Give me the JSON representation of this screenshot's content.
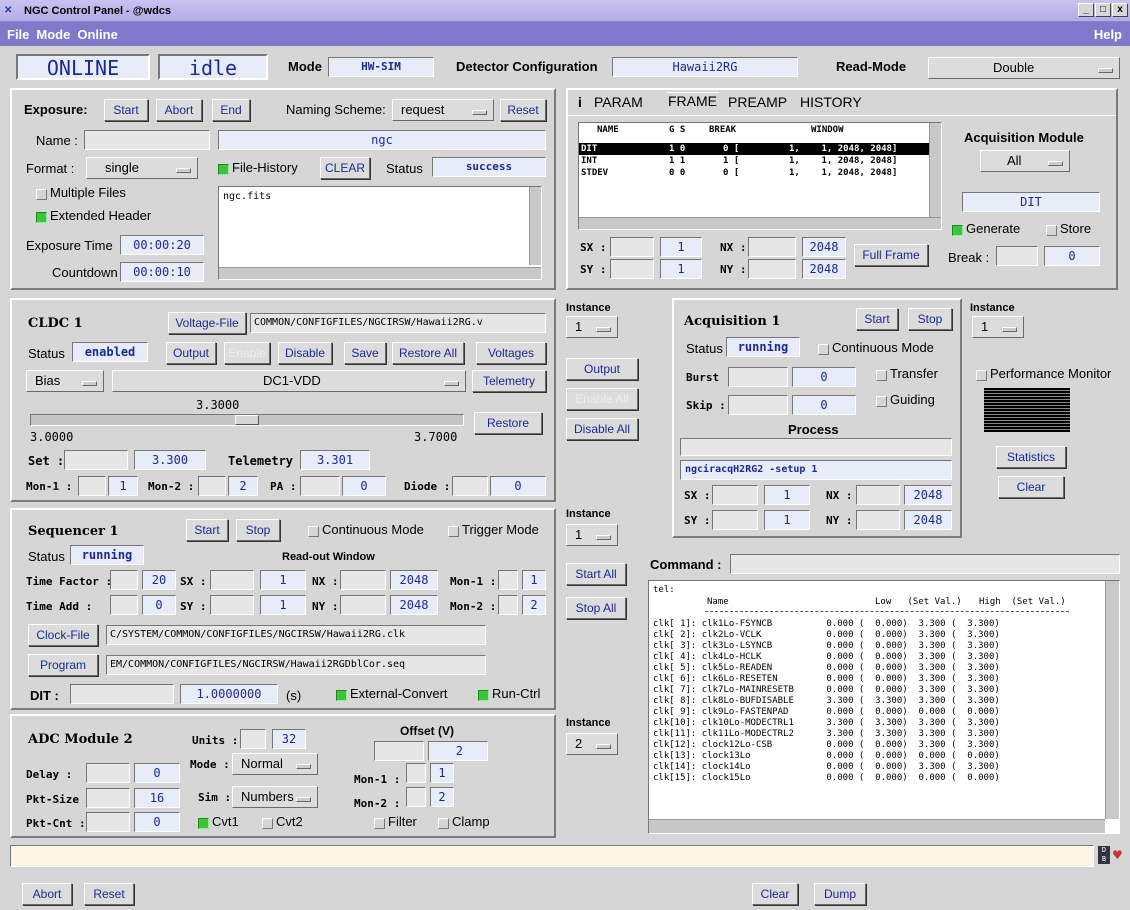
{
  "window": {
    "title": "NGC Control Panel - @wdcs",
    "logo": "NGC",
    "min": "_",
    "max": "□",
    "close": "x"
  },
  "menu": {
    "file": "File",
    "mode": "Mode",
    "online": "Online",
    "help": "Help"
  },
  "topbar": {
    "online": "ONLINE",
    "state": "idle",
    "mode_label": "Mode",
    "mode_value": "HW-SIM",
    "det_label": "Detector Configuration",
    "det_value": "Hawaii2RG",
    "read_label": "Read-Mode",
    "read_value": "Double"
  },
  "exposure": {
    "title": "Exposure:",
    "start": "Start",
    "abort": "Abort",
    "end": "End",
    "naming_label": "Naming Scheme:",
    "naming_value": "request",
    "reset": "Reset",
    "name_label": "Name :",
    "name_value": "",
    "name_display": "ngc",
    "format_label": "Format :",
    "format_value": "single",
    "file_history": "File-History",
    "clear": "CLEAR",
    "status_label": "Status",
    "status_value": "success",
    "multiple_files": "Multiple Files",
    "extended_header": "Extended Header",
    "file_list": "ngc.fits",
    "exptime_label": "Exposure Time",
    "exptime_value": "00:00:20",
    "countdown_label": "Countdown",
    "countdown_value": "00:00:10"
  },
  "frame": {
    "tabs": [
      "i",
      "PARAM",
      "FRAME",
      "PREAMP",
      "HISTORY"
    ],
    "headers": {
      "name": "NAME",
      "gs": "G S",
      "brk": "BREAK",
      "win": "WINDOW"
    },
    "rows": [
      {
        "name": "DIT",
        "gs": "1 0",
        "brk": "0 [",
        "win": "1,    1, 2048, 2048]"
      },
      {
        "name": "INT",
        "gs": "1 1",
        "brk": "1 [",
        "win": "1,    1, 2048, 2048]"
      },
      {
        "name": "STDEV",
        "gs": "0 0",
        "brk": "0 [",
        "win": "1,    1, 2048, 2048]"
      }
    ],
    "sx_label": "SX :",
    "sx": "1",
    "nx_label": "NX :",
    "nx": "2048",
    "sy_label": "SY :",
    "sy": "1",
    "ny_label": "NY :",
    "ny": "2048",
    "full_frame": "Full Frame",
    "acq_mod_label": "Acquisition Module",
    "acq_mod_value": "All",
    "dit": "DIT",
    "generate": "Generate",
    "store": "Store",
    "break_label": "Break :",
    "break_value": "0"
  },
  "cldc": {
    "title": "CLDC 1",
    "voltage_file": "Voltage-File",
    "voltage_path": "COMMON/CONFIGFILES/NGCIRSW/Hawaii2RG.v",
    "status_label": "Status",
    "status_value": "enabled",
    "output": "Output",
    "enable": "Enable",
    "disable": "Disable",
    "save": "Save",
    "restore_all": "Restore All",
    "voltages": "Voltages",
    "bias": "Bias",
    "dc": "DC1-VDD",
    "telemetry": "Telemetry",
    "slider_value": "3.3000",
    "slider_level": 0.5,
    "min": "3.0000",
    "max": "3.7000",
    "restore": "Restore",
    "set_label": "Set :",
    "set_value": "3.300",
    "tel_label": "Telemetry :",
    "tel_value": "3.301",
    "mon1_label": "Mon-1 :",
    "mon1": "1",
    "mon2_label": "Mon-2 :",
    "mon2": "2",
    "pa_label": "PA :",
    "pa": "0",
    "diode_label": "Diode :",
    "diode": "0"
  },
  "instances": {
    "label": "Instance",
    "i1": "1",
    "i2": "1",
    "i3": "1",
    "i4": "2",
    "output": "Output",
    "enable_all": "Enable All",
    "disable_all": "Disable All",
    "start_all": "Start All",
    "stop_all": "Stop All"
  },
  "acq": {
    "title": "Acquisition 1",
    "start": "Start",
    "stop": "Stop",
    "status_label": "Status",
    "status_value": "running",
    "continuous": "Continuous Mode",
    "burst_label": "Burst :",
    "burst": "0",
    "transfer": "Transfer",
    "skip_label": "Skip :",
    "skip": "0",
    "guiding": "Guiding",
    "process_label": "Process",
    "process_value": "ngciracqH2RG2 -setup 1",
    "sx_label": "SX :",
    "sx": "1",
    "nx_label": "NX :",
    "nx": "2048",
    "sy_label": "SY :",
    "sy": "1",
    "ny_label": "NY :",
    "ny": "2048"
  },
  "perf": {
    "performance": "Performance Monitor",
    "statistics": "Statistics",
    "clear": "Clear"
  },
  "seq": {
    "title": "Sequencer 1",
    "start": "Start",
    "stop": "Stop",
    "continuous": "Continuous Mode",
    "trigger": "Trigger Mode",
    "status_label": "Status",
    "status_value": "running",
    "readout": "Read-out Window",
    "tf_label": "Time Factor :",
    "tf": "20",
    "sx_label": "SX :",
    "sx": "1",
    "nx_label": "NX :",
    "nx": "2048",
    "mon1_label": "Mon-1 :",
    "mon1": "1",
    "ta_label": "Time Add :",
    "ta": "0",
    "sy_label": "SY :",
    "sy": "1",
    "ny_label": "NY :",
    "ny": "2048",
    "mon2_label": "Mon-2 :",
    "mon2": "2",
    "clock_file": "Clock-File",
    "clock_path": "C/SYSTEM/COMMON/CONFIGFILES/NGCIRSW/Hawaii2RG.clk",
    "program": "Program",
    "program_path": "EM/COMMON/CONFIGFILES/NGCIRSW/Hawaii2RGDblCor.seq",
    "dit_label": "DIT :",
    "dit": "1.0000000",
    "dit_unit": "(s)",
    "ext_convert": "External-Convert",
    "run_ctrl": "Run-Ctrl"
  },
  "adc": {
    "title": "ADC Module 2",
    "units_label": "Units :",
    "units": "32",
    "offset_label": "Offset (V)",
    "offset": "2",
    "delay_label": "Delay :",
    "delay": "0",
    "mode_label": "Mode :",
    "mode": "Normal",
    "mon1_label": "Mon-1 :",
    "mon1": "1",
    "pkt_size_label": "Pkt-Size :",
    "pkt_size": "16",
    "sim_label": "Sim :",
    "sim": "Numbers",
    "mon2_label": "Mon-2 :",
    "mon2": "2",
    "pkt_cnt_label": "Pkt-Cnt :",
    "pkt_cnt": "0",
    "cvt1": "Cvt1",
    "cvt2": "Cvt2",
    "filter": "Filter",
    "clamp": "Clamp"
  },
  "command": {
    "label": "Command :",
    "value": "",
    "tel": "tel:",
    "col_name": "Name",
    "col_low": "Low   (Set Val.)",
    "col_high": "High  (Set Val.)",
    "rows": [
      "clk[ 1]: clk1Lo-FSYNCB          0.000 (  0.000)  3.300 (  3.300)",
      "clk[ 2]: clk2Lo-VCLK            0.000 (  0.000)  3.300 (  3.300)",
      "clk[ 3]: clk3Lo-LSYNCB          0.000 (  0.000)  3.300 (  3.300)",
      "clk[ 4]: clk4Lo-HCLK            0.000 (  0.000)  3.300 (  3.300)",
      "clk[ 5]: clk5Lo-READEN          0.000 (  0.000)  3.300 (  3.300)",
      "clk[ 6]: clk6Lo-RESETEN         0.000 (  0.000)  3.300 (  3.300)",
      "clk[ 7]: clk7Lo-MAINRESETB      0.000 (  0.000)  3.300 (  3.300)",
      "clk[ 8]: clk8Lo-BUFDISABLE      3.300 (  3.300)  3.300 (  3.300)",
      "clk[ 9]: clk9Lo-FASTENPAD       0.000 (  0.000)  0.000 (  0.000)",
      "clk[10]: clk10Lo-MODECTRL1      3.300 (  3.300)  3.300 (  3.300)",
      "clk[11]: clk11Lo-MODECTRL2      3.300 (  3.300)  3.300 (  3.300)",
      "clk[12]: clock12Lo-CSB          0.000 (  0.000)  3.300 (  3.300)",
      "clk[13]: clock13Lo              0.000 (  0.000)  0.000 (  0.000)",
      "clk[14]: clock14Lo              0.000 (  0.000)  3.300 (  3.300)",
      "clk[15]: clock15Lo              0.000 (  0.000)  0.000 (  0.000)"
    ]
  },
  "status_bar": {
    "value": "",
    "db_icon": "D B",
    "heart": "♥"
  },
  "bottom": {
    "abort": "Abort",
    "reset": "Reset",
    "clear": "Clear",
    "dump": "Dump"
  }
}
